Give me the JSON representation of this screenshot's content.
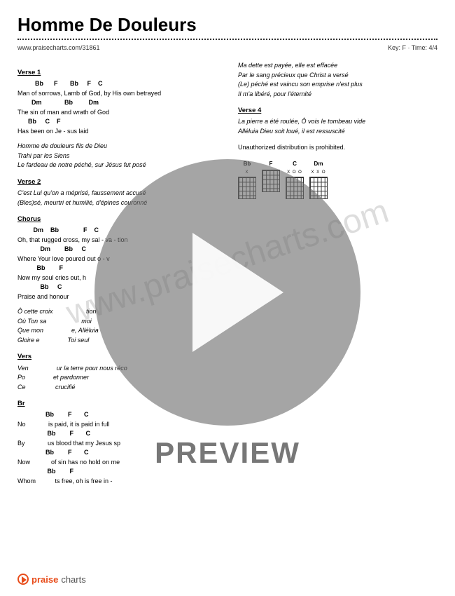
{
  "title": "Homme De Douleurs",
  "url": "www.praisecharts.com/31861",
  "key_time": "Key: F · Time: 4/4",
  "watermark": "www.praisecharts.com",
  "preview_label": "PREVIEW",
  "footer_brand1": "praise",
  "footer_brand2": "charts",
  "left": {
    "v1_head": "Verse 1",
    "v1_c1": "          Bb      F       Bb     F    C",
    "v1_l1": "Man of sorrows, Lamb of God, by His own betrayed",
    "v1_c2": "        Dm             Bb         Dm",
    "v1_l2": "The sin of man and wrath of God",
    "v1_c3": "      Bb     C    F",
    "v1_l3": "Has been on Je - sus laid",
    "v1_i1": "Homme de douleurs fils de Dieu",
    "v1_i2": "Trahi par les Siens",
    "v1_i3": "Le fardeau de notre péché, sur Jésus fut posé",
    "v2_head": "Verse 2",
    "v2_i1": "C'est Lui qu'on a méprisé, faussement accusé",
    "v2_i2": "(Bles)sé, meurtri et humilié, d'épines couronné",
    "ch_head": "Chorus",
    "ch_c1": "         Dm    Bb              F    C",
    "ch_l1": "Oh, that rugged cross, my sal - va - tion",
    "ch_c2": "             Dm        Bb     C",
    "ch_l2": "Where Your love poured out o - v",
    "ch_c3": "           Bb        F",
    "ch_l3": "Now my soul cries out, h",
    "ch_c4": "             Bb     C",
    "ch_l4": "Praise and honour",
    "ch_i1": "Ô cette croix                   tion",
    "ch_i2": "Où Ton sa                    moi",
    "ch_i3": "Que mon                e, Alléluia",
    "ch_i4": "Gloire e                Toi seul",
    "v3_head": "Vers",
    "v3_i1": "Ven                ur la terre pour nous réco",
    "v3_i2": "Po                et pardonner",
    "v3_i3": "Ce                 crucifié",
    "br_head": "Br",
    "br_c1": "                Bb        F       C",
    "br_l1": "No             is paid, it is paid in full",
    "br_c2": "                 Bb        F       C",
    "br_l2": "By             us blood that my Jesus sp",
    "br_c3": "                Bb        F       C",
    "br_l3": "Now            of sin has no hold on me",
    "br_c4": "                 Bb        F",
    "br_l4": "Whom           ts free, oh is free in -"
  },
  "right": {
    "i1": "Ma dette est payée, elle est effacée",
    "i2": "Par le sang précieux que Christ a versé",
    "i3": "(Le) péché est vaincu son emprise n'est plus",
    "i4": "Il m'a libéré, pour l'éternité",
    "v4_head": "Verse 4",
    "v4_i1": "La pierre a été roulée, Ô vois le tombeau vide",
    "v4_i2": "Alléluia Dieu soit loué, il est ressuscité",
    "note": "Unauthorized distribution is prohibited."
  },
  "chords": {
    "c1_label": "Bb",
    "c1_f": "X           ",
    "c2_label": "F",
    "c2_f": "            ",
    "c3_label": "C",
    "c3_f": "X     O   O",
    "c4_label": "Dm",
    "c4_f": "X X O      "
  }
}
